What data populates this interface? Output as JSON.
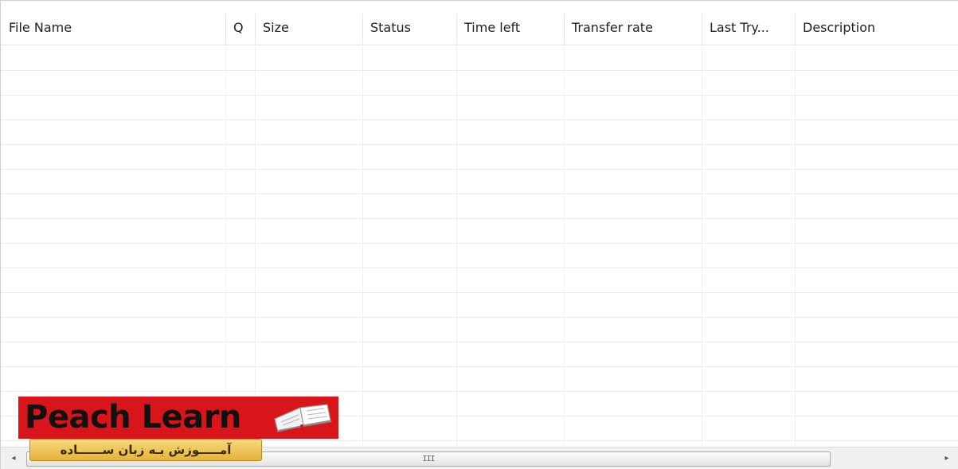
{
  "columns": [
    {
      "label": "File Name"
    },
    {
      "label": "Q"
    },
    {
      "label": "Size"
    },
    {
      "label": "Status"
    },
    {
      "label": "Time left"
    },
    {
      "label": "Transfer rate"
    },
    {
      "label": "Last Try..."
    },
    {
      "label": "Description"
    }
  ],
  "rows": [],
  "scrollbar": {
    "left_arrow": "◂",
    "right_arrow": "▸",
    "thumb_grip": "III"
  },
  "watermark": {
    "brand": "Peach Learn",
    "tagline": "آمـــــوزش بـه زبان ســــــاده",
    "colors": {
      "red": "#d8151a",
      "gold": "#e4b33d"
    }
  }
}
